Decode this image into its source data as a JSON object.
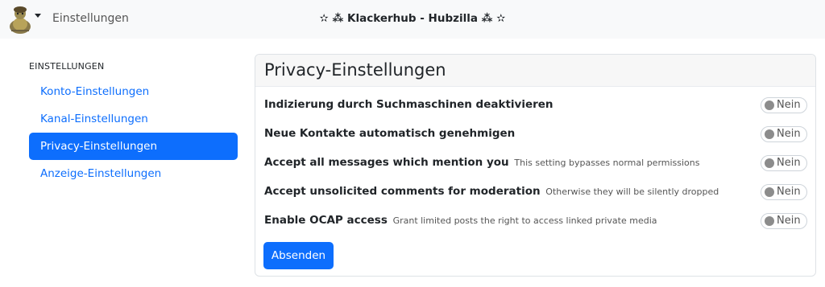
{
  "navbar": {
    "settings_link": "Einstellungen",
    "site_title": "✫ ⁂ Klackerhub - Hubzilla ⁂ ✫"
  },
  "sidebar": {
    "heading": "EINSTELLUNGEN",
    "items": [
      {
        "label": "Konto-Einstellungen",
        "active": false
      },
      {
        "label": "Kanal-Einstellungen",
        "active": false
      },
      {
        "label": "Privacy-Einstellungen",
        "active": true
      },
      {
        "label": "Anzeige-Einstellungen",
        "active": false
      }
    ]
  },
  "panel": {
    "title": "Privacy-Einstellungen",
    "rows": [
      {
        "label": "Indizierung durch Suchmaschinen deaktivieren",
        "help": "",
        "value": "Nein"
      },
      {
        "label": "Neue Kontakte automatisch genehmigen",
        "help": "",
        "value": "Nein"
      },
      {
        "label": "Accept all messages which mention you",
        "help": "This setting bypasses normal permissions",
        "value": "Nein"
      },
      {
        "label": "Accept unsolicited comments for moderation",
        "help": "Otherwise they will be silently dropped",
        "value": "Nein"
      },
      {
        "label": "Enable OCAP access",
        "help": "Grant limited posts the right to access linked private media",
        "value": "Nein"
      }
    ],
    "submit_label": "Absenden"
  },
  "colors": {
    "accent": "#0d6efd",
    "navbar_bg": "#f8f9fa",
    "header_bg": "#f7f7f7"
  }
}
